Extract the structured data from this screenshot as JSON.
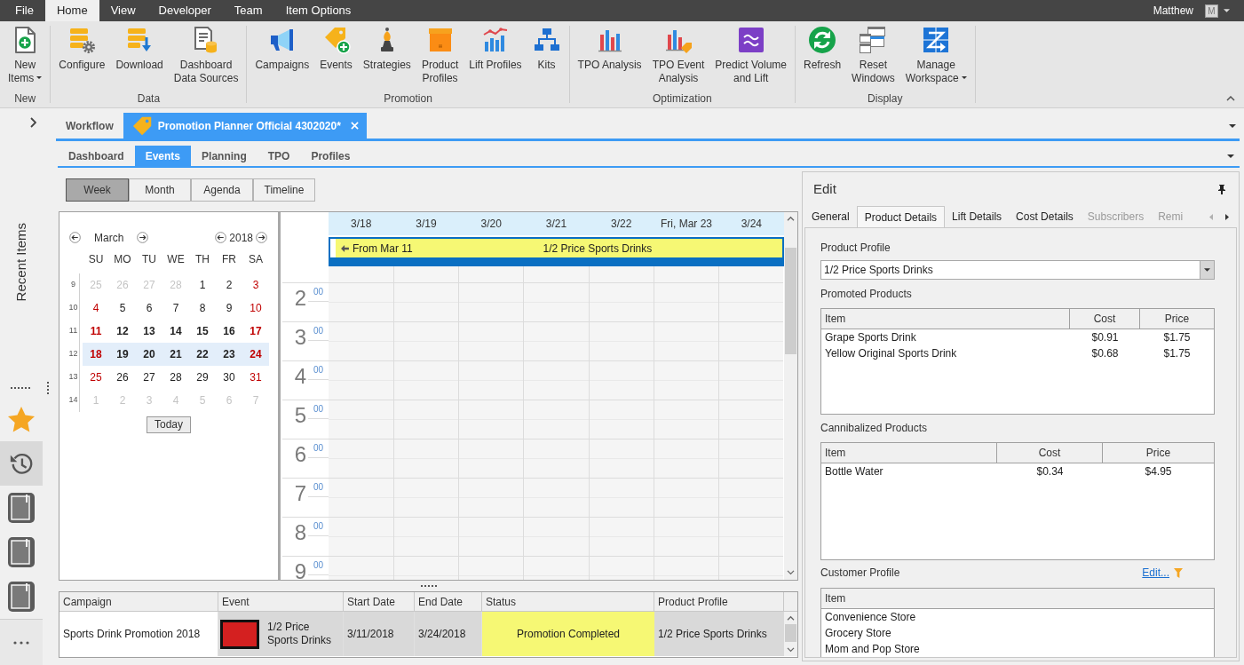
{
  "menu_bar": {
    "tabs": [
      {
        "label": "File",
        "selected": false
      },
      {
        "label": "Home",
        "selected": true
      },
      {
        "label": "View",
        "selected": false
      },
      {
        "label": "Developer",
        "selected": false
      },
      {
        "label": "Team",
        "selected": false
      },
      {
        "label": "Item Options",
        "selected": false
      }
    ],
    "user": {
      "name": "Matthew",
      "avatar": "M"
    }
  },
  "ribbon": {
    "groups": [
      {
        "label": "New",
        "buttons": [
          {
            "kind": "new-item",
            "label": "New\nItems",
            "has_menu": true
          }
        ]
      },
      {
        "label": "Data",
        "buttons": [
          {
            "kind": "configure",
            "label": "Configure",
            "has_menu": false
          },
          {
            "kind": "download",
            "label": "Download",
            "has_menu": false
          },
          {
            "kind": "data-sources",
            "label": "Dashboard\nData Sources",
            "has_menu": false
          }
        ]
      },
      {
        "label": "Promotion",
        "buttons": [
          {
            "kind": "campaigns",
            "label": "Campaigns",
            "has_menu": false
          },
          {
            "kind": "events",
            "label": "Events",
            "has_menu": false
          },
          {
            "kind": "strategies",
            "label": "Strategies",
            "has_menu": false
          },
          {
            "kind": "product-profiles",
            "label": "Product\nProfiles",
            "has_menu": false
          },
          {
            "kind": "lift-profiles",
            "label": "Lift Profiles",
            "has_menu": false
          },
          {
            "kind": "kits",
            "label": "Kits",
            "has_menu": false
          }
        ]
      },
      {
        "label": "Optimization",
        "buttons": [
          {
            "kind": "tpo-analysis",
            "label": "TPO Analysis",
            "has_menu": false
          },
          {
            "kind": "tpo-event-analysis",
            "label": "TPO Event\nAnalysis",
            "has_menu": false
          },
          {
            "kind": "predict",
            "label": "Predict Volume\nand Lift",
            "has_menu": false
          }
        ]
      },
      {
        "label": "Display",
        "buttons": [
          {
            "kind": "refresh",
            "label": "Refresh",
            "has_menu": false
          },
          {
            "kind": "reset-windows",
            "label": "Reset\nWindows",
            "has_menu": false
          },
          {
            "kind": "manage-workspace",
            "label": "Manage\nWorkspace",
            "has_menu": true
          }
        ]
      }
    ]
  },
  "sidebar": {
    "title": "Recent Items",
    "items": [
      {
        "kind": "favorites",
        "selected": false
      },
      {
        "kind": "history",
        "selected": true
      },
      {
        "kind": "document",
        "selected": false
      },
      {
        "kind": "document",
        "selected": false
      },
      {
        "kind": "document",
        "selected": false
      }
    ]
  },
  "document_tabs": [
    {
      "label": "Workflow",
      "kind": "page",
      "selected": false
    },
    {
      "label": "Promotion Planner Official 4302020*",
      "kind": "promotion",
      "selected": true
    }
  ],
  "section_tabs": [
    {
      "label": "Dashboard",
      "selected": false
    },
    {
      "label": "Events",
      "selected": true
    },
    {
      "label": "Planning",
      "selected": false
    },
    {
      "label": "TPO",
      "selected": false
    },
    {
      "label": "Profiles",
      "selected": false
    }
  ],
  "view_buttons": [
    {
      "label": "Week",
      "selected": true
    },
    {
      "label": "Month",
      "selected": false
    },
    {
      "label": "Agenda",
      "selected": false
    },
    {
      "label": "Timeline",
      "selected": false
    }
  ],
  "mini_calendar": {
    "month": "March",
    "year": "2018",
    "weekdays": [
      "SU",
      "MO",
      "TU",
      "WE",
      "TH",
      "FR",
      "SA"
    ],
    "weeks": [
      {
        "number": "9",
        "selected": false,
        "has_events": false,
        "days": [
          {
            "label": "25",
            "in_month": false
          },
          {
            "label": "26",
            "in_month": false
          },
          {
            "label": "27",
            "in_month": false
          },
          {
            "label": "28",
            "in_month": false
          },
          {
            "label": "1",
            "in_month": true
          },
          {
            "label": "2",
            "in_month": true
          },
          {
            "label": "3",
            "in_month": true
          }
        ]
      },
      {
        "number": "10",
        "selected": false,
        "has_events": false,
        "days": [
          {
            "label": "4",
            "in_month": true
          },
          {
            "label": "5",
            "in_month": true
          },
          {
            "label": "6",
            "in_month": true
          },
          {
            "label": "7",
            "in_month": true
          },
          {
            "label": "8",
            "in_month": true
          },
          {
            "label": "9",
            "in_month": true
          },
          {
            "label": "10",
            "in_month": true
          }
        ]
      },
      {
        "number": "11",
        "selected": false,
        "has_events": true,
        "days": [
          {
            "label": "11",
            "in_month": true
          },
          {
            "label": "12",
            "in_month": true
          },
          {
            "label": "13",
            "in_month": true
          },
          {
            "label": "14",
            "in_month": true
          },
          {
            "label": "15",
            "in_month": true
          },
          {
            "label": "16",
            "in_month": true
          },
          {
            "label": "17",
            "in_month": true
          }
        ]
      },
      {
        "number": "12",
        "selected": true,
        "has_events": true,
        "days": [
          {
            "label": "18",
            "in_month": true
          },
          {
            "label": "19",
            "in_month": true
          },
          {
            "label": "20",
            "in_month": true
          },
          {
            "label": "21",
            "in_month": true
          },
          {
            "label": "22",
            "in_month": true
          },
          {
            "label": "23",
            "in_month": true
          },
          {
            "label": "24",
            "in_month": true
          }
        ]
      },
      {
        "number": "13",
        "selected": false,
        "has_events": false,
        "days": [
          {
            "label": "25",
            "in_month": true
          },
          {
            "label": "26",
            "in_month": true
          },
          {
            "label": "27",
            "in_month": true
          },
          {
            "label": "28",
            "in_month": true
          },
          {
            "label": "29",
            "in_month": true
          },
          {
            "label": "30",
            "in_month": true
          },
          {
            "label": "31",
            "in_month": true
          }
        ]
      },
      {
        "number": "14",
        "selected": false,
        "has_events": false,
        "days": [
          {
            "label": "1",
            "in_month": false
          },
          {
            "label": "2",
            "in_month": false
          },
          {
            "label": "3",
            "in_month": false
          },
          {
            "label": "4",
            "in_month": false
          },
          {
            "label": "5",
            "in_month": false
          },
          {
            "label": "6",
            "in_month": false
          },
          {
            "label": "7",
            "in_month": false
          }
        ]
      }
    ],
    "today_button": "Today"
  },
  "day_view": {
    "columns": [
      "3/18",
      "3/19",
      "3/20",
      "3/21",
      "3/22",
      "Fri, Mar 23",
      "3/24"
    ],
    "all_day_event": {
      "continued_label": "From Mar 11",
      "title": "1/2 Price Sports Drinks",
      "color": "#f6f874"
    },
    "hours": [
      {
        "hour": "2",
        "minutes": "00"
      },
      {
        "hour": "3",
        "minutes": "00"
      },
      {
        "hour": "4",
        "minutes": "00"
      },
      {
        "hour": "5",
        "minutes": "00"
      },
      {
        "hour": "6",
        "minutes": "00"
      },
      {
        "hour": "7",
        "minutes": "00"
      },
      {
        "hour": "8",
        "minutes": "00"
      },
      {
        "hour": "9",
        "minutes": "00"
      }
    ]
  },
  "events_grid": {
    "columns": [
      "Campaign",
      "Event",
      "Start Date",
      "End Date",
      "Status",
      "Product Profile"
    ],
    "rows": [
      {
        "campaign": "Sports Drink Promotion 2018",
        "event": "1/2 Price Sports Drinks",
        "start_date": "3/11/2018",
        "end_date": "3/24/2018",
        "status": "Promotion Completed",
        "color": "#f6f874",
        "product_profile": "1/2 Price Sports Drinks",
        "selected": true
      }
    ]
  },
  "edit_panel": {
    "title": "Edit",
    "tabs": [
      {
        "label": "General",
        "selected": false,
        "disabled": false
      },
      {
        "label": "Product Details",
        "selected": true,
        "disabled": false
      },
      {
        "label": "Lift Details",
        "selected": false,
        "disabled": false
      },
      {
        "label": "Cost Details",
        "selected": false,
        "disabled": false
      },
      {
        "label": "Subscribers",
        "selected": false,
        "disabled": true
      },
      {
        "label": "Remi",
        "selected": false,
        "disabled": true
      }
    ],
    "product_profile": {
      "label": "Product Profile",
      "value": "1/2 Price Sports Drinks"
    },
    "promoted_products": {
      "label": "Promoted Products",
      "columns": [
        "Item",
        "Cost",
        "Price"
      ],
      "rows": [
        [
          "Grape Sports Drink",
          "$0.91",
          "$1.75"
        ],
        [
          "Yellow Original Sports Drink",
          "$0.68",
          "$1.75"
        ]
      ]
    },
    "cannibalized_products": {
      "label": "Cannibalized Products",
      "columns": [
        "Item",
        "Cost",
        "Price"
      ],
      "rows": [
        [
          "Bottle Water",
          "$0.34",
          "$4.95"
        ]
      ]
    },
    "customer_profile": {
      "label": "Customer Profile",
      "edit_link": "Edit...",
      "columns": [
        "Item"
      ],
      "rows": [
        [
          "Convenience Store"
        ],
        [
          "Grocery Store"
        ],
        [
          "Mom and Pop Store"
        ]
      ]
    }
  }
}
